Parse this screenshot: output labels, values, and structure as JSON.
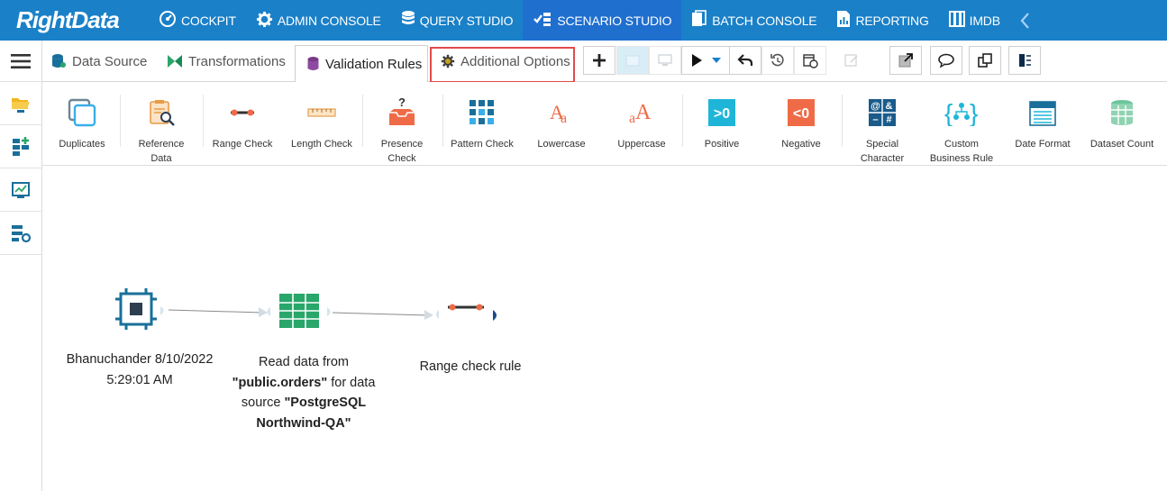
{
  "brand": {
    "logo_text": "RightData"
  },
  "topnav": {
    "items": [
      {
        "label": "COCKPIT",
        "icon": "gauge-icon",
        "active": false
      },
      {
        "label": "ADMIN CONSOLE",
        "icon": "gear-icon",
        "active": false
      },
      {
        "label": "QUERY STUDIO",
        "icon": "database-icon",
        "active": false
      },
      {
        "label": "SCENARIO STUDIO",
        "icon": "scenario-icon",
        "active": true
      },
      {
        "label": "BATCH CONSOLE",
        "icon": "batch-icon",
        "active": false
      },
      {
        "label": "REPORTING",
        "icon": "report-icon",
        "active": false
      },
      {
        "label": "IMDB",
        "icon": "imdb-icon",
        "active": false
      }
    ],
    "prev_icon": "chevron-left-icon"
  },
  "tabs": {
    "data_source": "Data Source",
    "transformations": "Transformations",
    "validation_rules": "Validation Rules",
    "additional_options": "Additional Options"
  },
  "rules": [
    {
      "label": "Duplicates",
      "icon": "duplicates-icon"
    },
    {
      "label": "Reference\nData",
      "icon": "reference-data-icon"
    },
    {
      "label": "Range Check",
      "icon": "range-check-icon"
    },
    {
      "label": "Length Check",
      "icon": "length-check-icon"
    },
    {
      "label": "Presence\nCheck",
      "icon": "presence-check-icon"
    },
    {
      "label": "Pattern Check",
      "icon": "pattern-check-icon"
    },
    {
      "label": "Lowercase",
      "icon": "lowercase-icon"
    },
    {
      "label": "Uppercase",
      "icon": "uppercase-icon"
    },
    {
      "label": "Positive",
      "icon": "positive-icon"
    },
    {
      "label": "Negative",
      "icon": "negative-icon"
    },
    {
      "label": "Special\nCharacter",
      "icon": "special-character-icon"
    },
    {
      "label": "Custom\nBusiness Rule",
      "icon": "custom-business-rule-icon"
    },
    {
      "label": "Date Format",
      "icon": "date-format-icon"
    },
    {
      "label": "Dataset Count",
      "icon": "dataset-count-icon"
    }
  ],
  "icon_glyphs": {
    "positive": ">0",
    "negative": "<0",
    "presence": "?",
    "special": [
      "@",
      "&",
      "–",
      "#"
    ]
  },
  "canvas": {
    "nodes": [
      {
        "lines": [
          "Bhanuchander 8/10/2022",
          "5:29:01 AM"
        ]
      },
      {
        "parts": [
          {
            "t": "Read data from",
            "b": false
          },
          {
            "t": "\"public.orders\"",
            "b": true
          },
          {
            "t": " for data",
            "b": false
          },
          {
            "t": "source ",
            "b": false
          },
          {
            "t": "\"PostgreSQL",
            "b": true
          },
          {
            "t": "Northwind-QA\"",
            "b": true
          }
        ]
      },
      {
        "lines": [
          "Range check rule"
        ]
      }
    ]
  },
  "colors": {
    "nav_bg": "#1a80c8",
    "nav_active": "#1f6fcf",
    "highlight": "#e14b4b",
    "teal": "#1a6f9a",
    "green": "#29a66a"
  }
}
